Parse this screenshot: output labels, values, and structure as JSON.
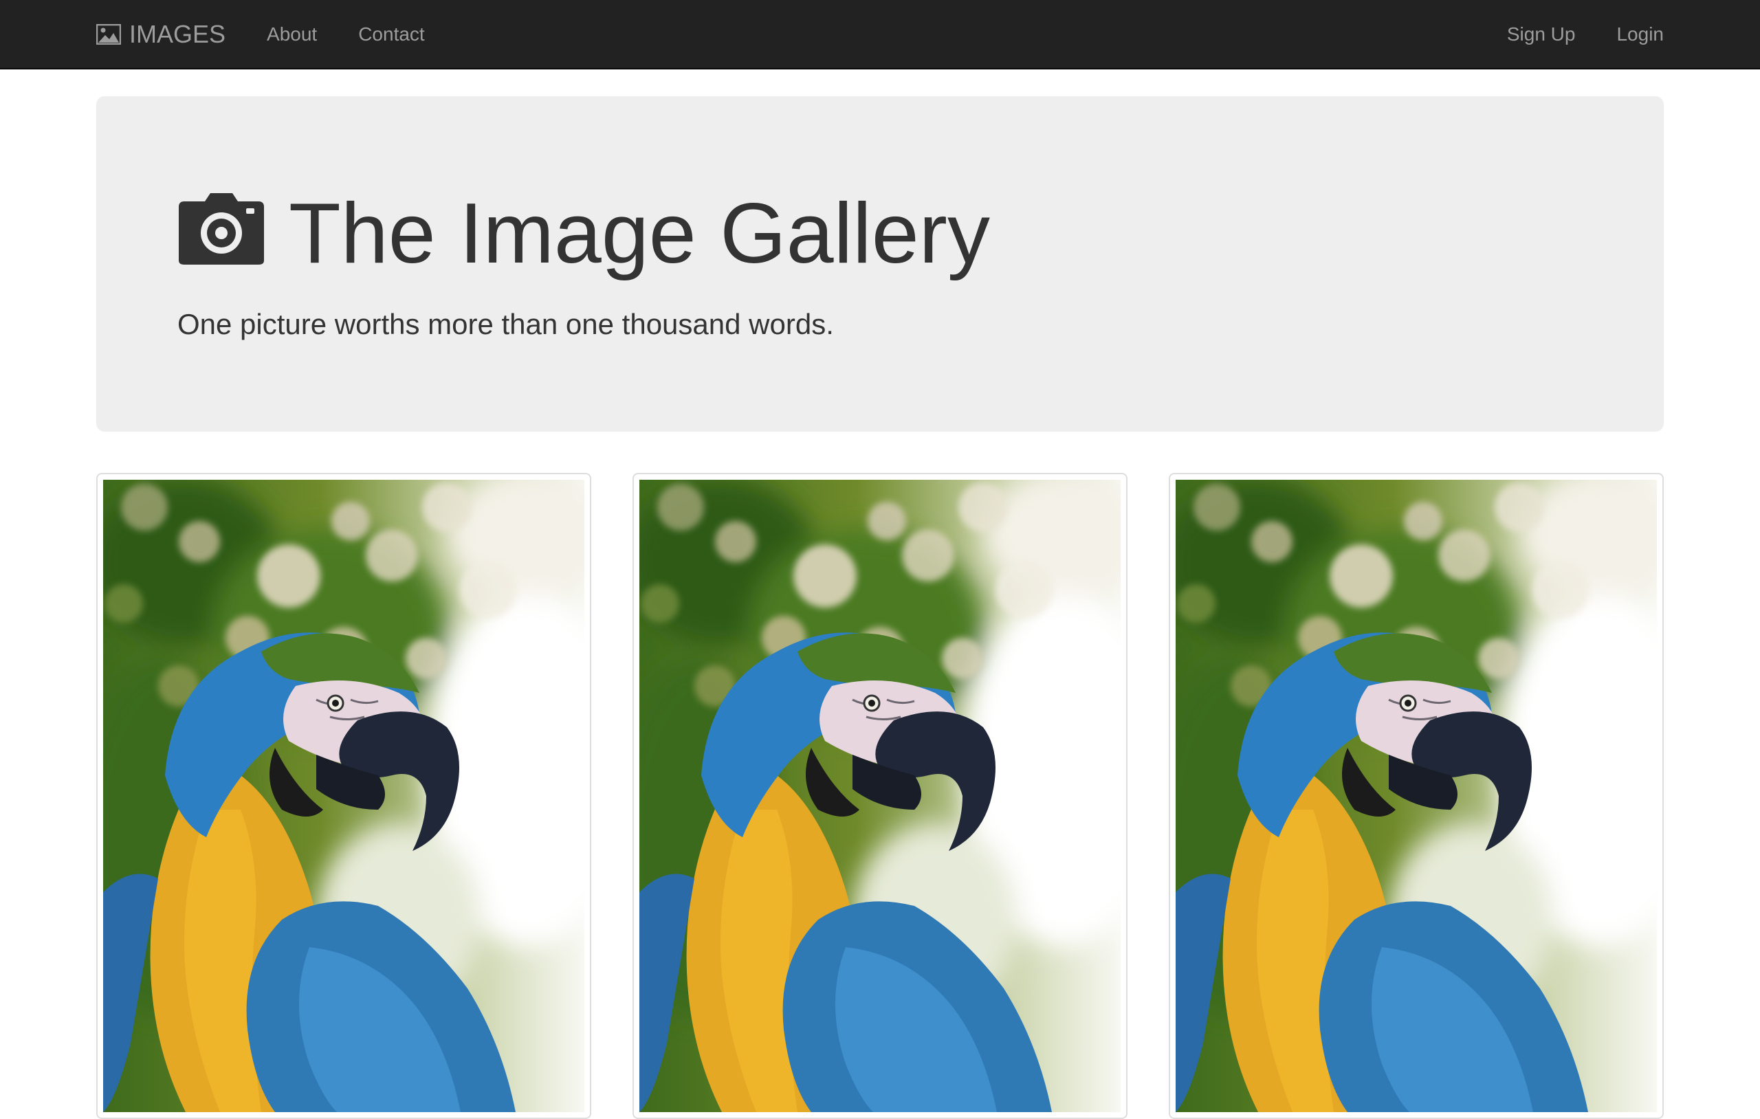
{
  "navbar": {
    "brand": "IMAGES",
    "brand_icon": "image-icon",
    "links": [
      "About",
      "Contact"
    ],
    "right_links": [
      "Sign Up",
      "Login"
    ]
  },
  "jumbotron": {
    "icon": "camera-icon",
    "title": "The Image Gallery",
    "subtitle": "One picture worths more than one thousand words."
  },
  "gallery": {
    "image_subject": "parrot",
    "count": 3
  },
  "colors": {
    "navbar_bg": "#222222",
    "nav_text": "#9d9d9d",
    "jumbotron_bg": "#eeeeee",
    "title_text": "#333333"
  }
}
